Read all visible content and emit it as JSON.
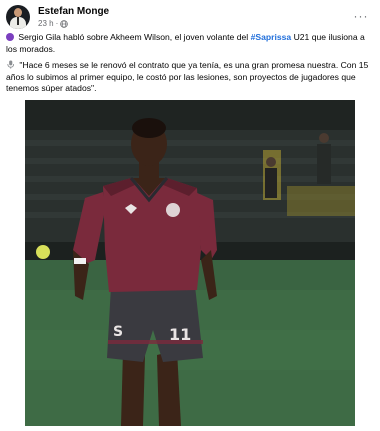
{
  "post": {
    "author": "Estefan Monge",
    "time": "23 h",
    "more_icon": "more-horizontal-icon",
    "privacy_icon": "globe-icon",
    "paragraph1": {
      "before": " Sergio Gila habló sobre Akheem Wilson, el joven volante del ",
      "hashtag": "#Saprissa",
      "after": " U21 que ilusiona a los morados."
    },
    "paragraph2": " \"Hace 6 meses se le renovó el contrato que ya tenía, es una gran promesa nuestra. Con 15 años lo subimos al primer equipo, le costó por las lesiones, son proyectos de jugadores que tenemos súper atados\".",
    "photo": {
      "jersey_number": "11",
      "badge_letter": "S",
      "colors": {
        "jersey": "#7a2a3c",
        "shorts": "#3a3a40",
        "pitch": "#3e6b45"
      }
    }
  }
}
